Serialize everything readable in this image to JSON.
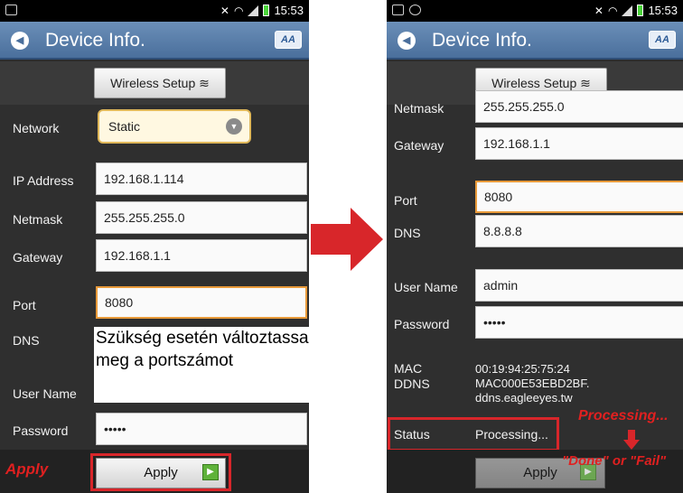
{
  "status_bar": {
    "time": "15:53"
  },
  "left_screen": {
    "title": "Device Info.",
    "logo_text": "AA",
    "wireless_button": "Wireless Setup",
    "network_label": "Network",
    "network_value": "Static",
    "ip_label": "IP Address",
    "ip_value": "192.168.1.114",
    "netmask_label": "Netmask",
    "netmask_value": "255.255.255.0",
    "gateway_label": "Gateway",
    "gateway_value": "192.168.1.1",
    "port_label": "Port",
    "port_value": "8080",
    "dns_label": "DNS",
    "user_label": "User Name",
    "password_label": "Password",
    "password_value": "•••••",
    "apply_button": "Apply",
    "apply_callout": "Apply",
    "note_text": "Szükség esetén változtassa meg a portszámot"
  },
  "right_screen": {
    "title": "Device Info.",
    "logo_text": "AA",
    "wireless_button": "Wireless Setup",
    "netmask_label": "Netmask",
    "netmask_value": "255.255.255.0",
    "gateway_label": "Gateway",
    "gateway_value": "192.168.1.1",
    "port_label": "Port",
    "port_value": "8080",
    "dns_label": "DNS",
    "dns_value": "8.8.8.8",
    "user_label": "User Name",
    "user_value": "admin",
    "password_label": "Password",
    "password_value": "•••••",
    "mac_label": "MAC",
    "mac_value": "00:19:94:25:75:24",
    "ddns_label": "DDNS",
    "ddns_value_1": "MAC000E53EBD2BF.",
    "ddns_value_2": "ddns.eagleeyes.tw",
    "status_label": "Status",
    "status_value": "Processing...",
    "processing_callout": "Processing...",
    "result_callout": "\"Done\" or \"Fail\"",
    "apply_button": "Apply"
  },
  "colors": {
    "title_bar": "#5a7fab",
    "callout_red": "#d8262a",
    "field_highlight": "#e89a3a"
  }
}
